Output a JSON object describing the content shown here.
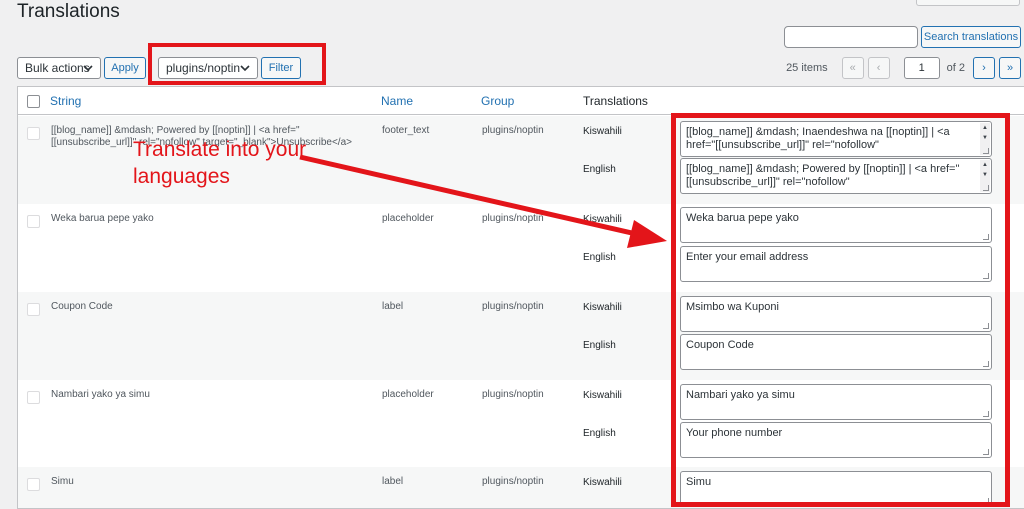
{
  "page": {
    "title": "Translations"
  },
  "search": {
    "placeholder": "",
    "button_label": "Search translations"
  },
  "toolbar": {
    "bulk_select": "Bulk actions",
    "apply_label": "Apply",
    "group_select": "plugins/noptin",
    "filter_label": "Filter"
  },
  "pagination": {
    "count": "25 items",
    "first": "«",
    "prev": "‹",
    "current": "1",
    "of": "of 2",
    "next": "›",
    "last": "»"
  },
  "table": {
    "headers": {
      "string": "String",
      "name": "Name",
      "group": "Group",
      "translations": "Translations"
    },
    "rows": [
      {
        "string": "[[blog_name]] &mdash; Powered by [[noptin]] | <a href=\"[[unsubscribe_url]]\" rel=\"nofollow\" target=\"_blank\">Unsubscribe</a>",
        "name": "footer_text",
        "group": "plugins/noptin",
        "lang1": "Kiswahili",
        "value1": "[[blog_name]] &mdash; Inaendeshwa na [[noptin]] | <a href=\"[[unsubscribe_url]]\" rel=\"nofollow\"",
        "lang2": "English",
        "value2": "[[blog_name]] &mdash; Powered by [[noptin]] | <a href=\"[[unsubscribe_url]]\" rel=\"nofollow\""
      },
      {
        "string": "Weka barua pepe yako",
        "name": "placeholder",
        "group": "plugins/noptin",
        "lang1": "Kiswahili",
        "value1": "Weka barua pepe yako",
        "lang2": "English",
        "value2": "Enter your email address"
      },
      {
        "string": "Coupon Code",
        "name": "label",
        "group": "plugins/noptin",
        "lang1": "Kiswahili",
        "value1": "Msimbo wa Kuponi",
        "lang2": "English",
        "value2": "Coupon Code"
      },
      {
        "string": "Nambari yako ya simu",
        "name": "placeholder",
        "group": "plugins/noptin",
        "lang1": "Kiswahili",
        "value1": "Nambari yako ya simu",
        "lang2": "English",
        "value2": "Your phone number"
      },
      {
        "string": "Simu",
        "name": "label",
        "group": "plugins/noptin",
        "lang1": "Kiswahili",
        "value1": "Simu"
      }
    ]
  },
  "annotation": {
    "text": "Translate into your languages"
  },
  "colors": {
    "accent": "#2271b1",
    "highlight": "#e3151a"
  }
}
